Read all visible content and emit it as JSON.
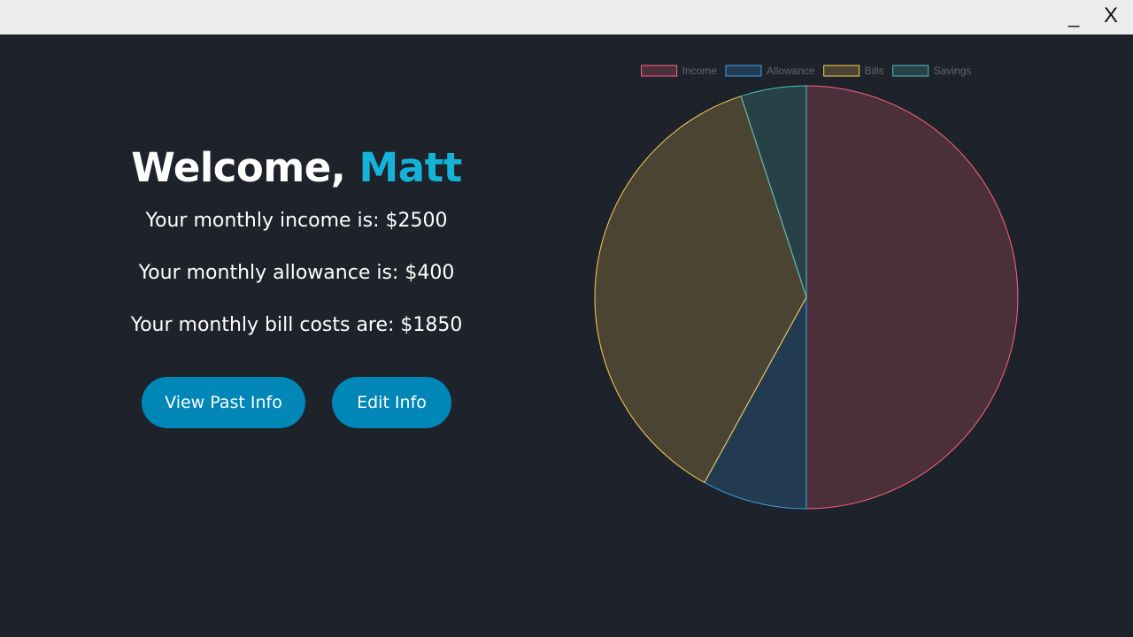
{
  "window": {
    "minimize_label": "_",
    "close_label": "X"
  },
  "welcome": {
    "greeting": "Welcome, ",
    "name": "Matt"
  },
  "info": {
    "income_line": "Your monthly income is: $2500",
    "allowance_line": "Your monthly allowance is: $400",
    "bills_line": "Your monthly bill costs are: $1850"
  },
  "buttons": {
    "view_past": "View Past Info",
    "edit": "Edit Info"
  },
  "colors": {
    "background": "#1e222a",
    "accent": "#15b3d8",
    "button": "#0087b8"
  },
  "chart_data": {
    "type": "pie",
    "title": "",
    "legend_position": "top",
    "categories": [
      "Income",
      "Allowance",
      "Bills",
      "Savings"
    ],
    "values": [
      2500,
      400,
      1850,
      250
    ],
    "border_colors": [
      "#ff6384",
      "#36a2eb",
      "#ffce56",
      "#4bc0c0"
    ],
    "fill_colors": [
      "rgba(255,99,132,0.2)",
      "rgba(54,162,235,0.2)",
      "rgba(255,206,86,0.2)",
      "rgba(75,192,192,0.2)"
    ]
  }
}
